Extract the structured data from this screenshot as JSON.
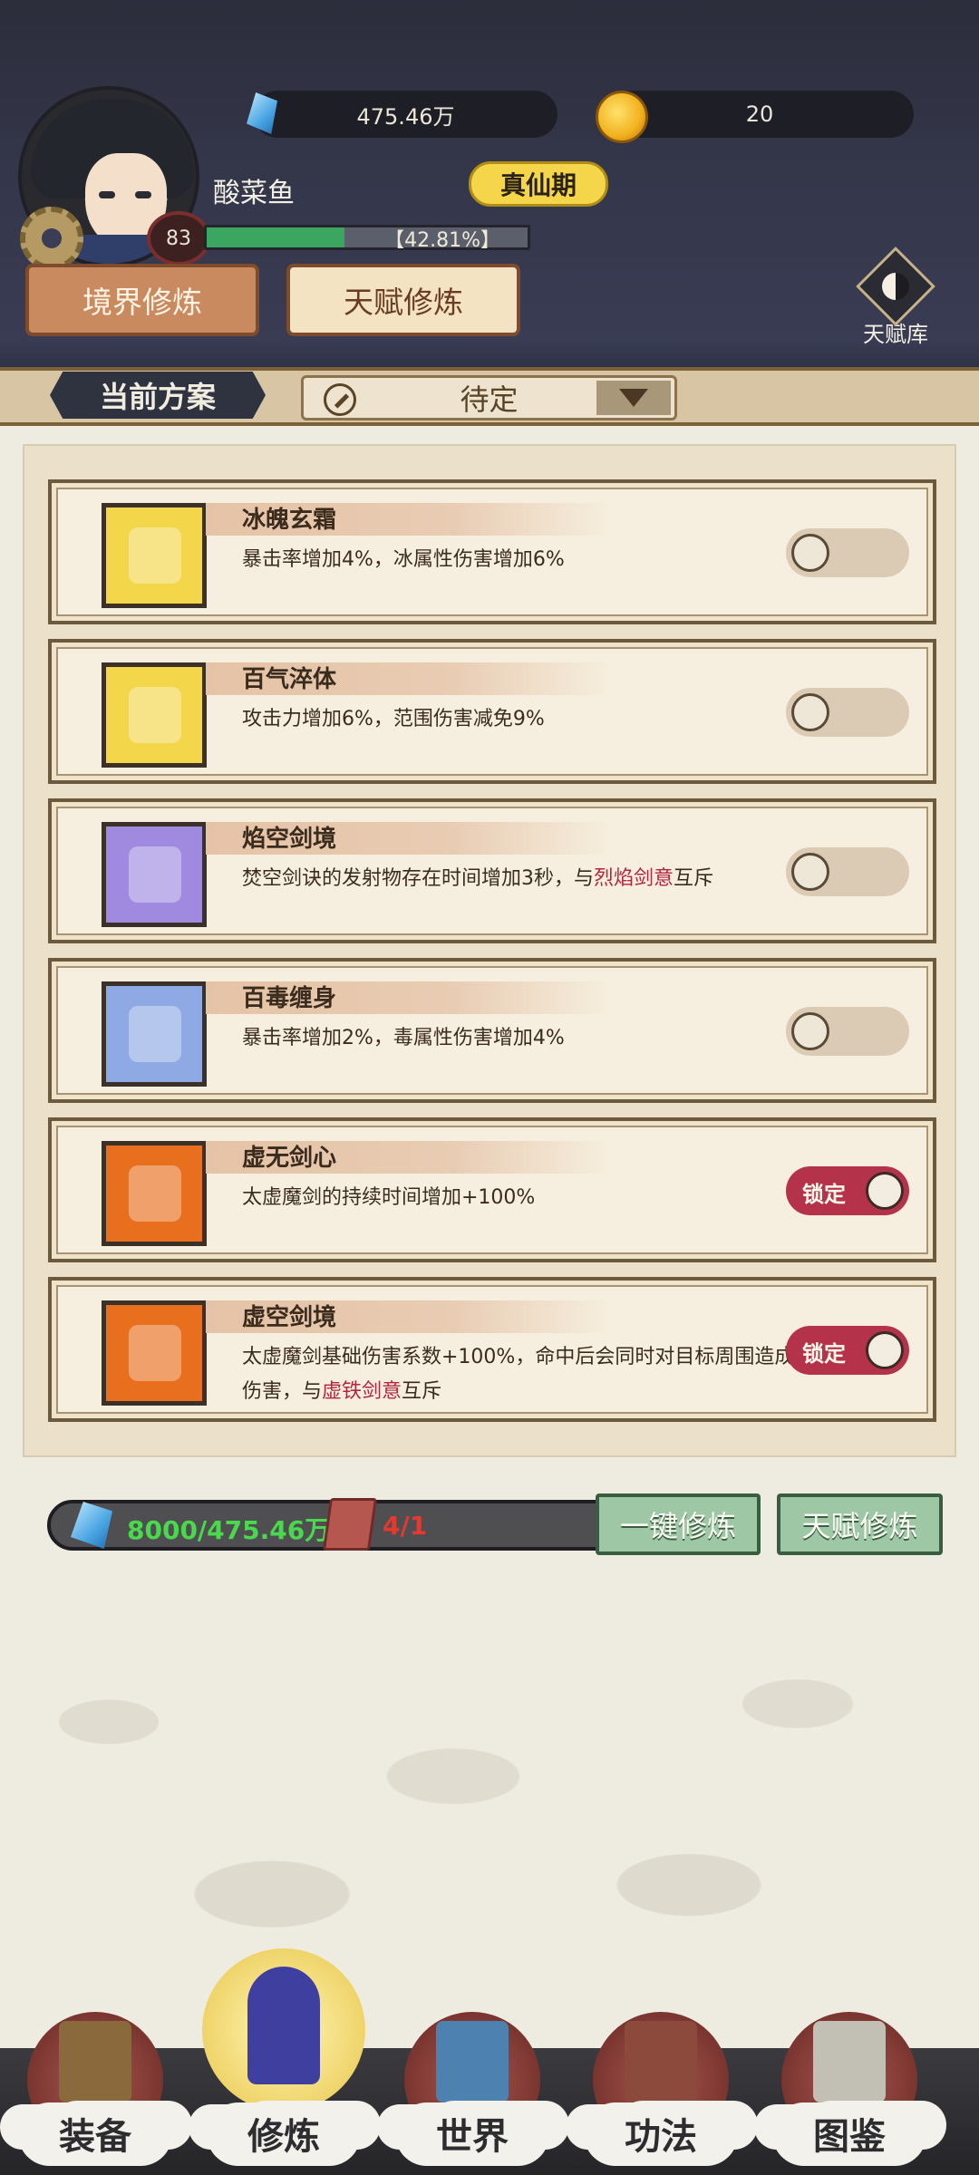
{
  "player": {
    "name": "酸菜鱼",
    "level": "83",
    "realm": "真仙期",
    "exp_text": "【42.81%】",
    "exp_progress": 0.4281
  },
  "resources": {
    "crystal": "475.46万",
    "gold": "20"
  },
  "tabs": {
    "realm_label": "境界修炼",
    "talent_label": "天赋修炼"
  },
  "talent_library_label": "天赋库",
  "scheme": {
    "label": "当前方案",
    "selected": "待定"
  },
  "talents": [
    {
      "name": "冰魄玄霜",
      "desc_parts": [
        "暴击率增加4%，冰属性伤害增加6%"
      ],
      "locked": false,
      "icon": "ice-sword-icon",
      "color": "#f3d64a"
    },
    {
      "name": "百气淬体",
      "desc_parts": [
        "攻击力增加6%，范围伤害减免9%"
      ],
      "locked": false,
      "icon": "flame-blade-icon",
      "color": "#f3d64a"
    },
    {
      "name": "焰空剑境",
      "desc_parts": [
        "焚空剑诀的发射物存在时间增加3秒，与",
        "烈焰剑意",
        "互斥"
      ],
      "locked": false,
      "icon": "fire-claw-icon",
      "color": "#9f8ae0"
    },
    {
      "name": "百毒缠身",
      "desc_parts": [
        "暴击率增加2%，毒属性伤害增加4%"
      ],
      "locked": false,
      "icon": "poison-sword-icon",
      "color": "#8ea9e3"
    },
    {
      "name": "虚无剑心",
      "desc_parts": [
        "太虚魔剑的持续时间增加+100%"
      ],
      "locked": true,
      "lock_label": "锁定",
      "icon": "void-sword-icon",
      "color": "#e86f1d"
    },
    {
      "name": "虚空剑境",
      "desc_parts": [
        "太虚魔剑基础伤害系数+100%，命中后会同时对目标周围造成伤害，与",
        "虚铁剑意",
        "互斥"
      ],
      "locked": true,
      "lock_label": "锁定",
      "icon": "dagger-icon",
      "color": "#e86f1d"
    }
  ],
  "cost": {
    "crystal": "8000/475.46万",
    "books": "4/1"
  },
  "actions": {
    "one_click": "一键修炼",
    "talent_train": "天赋修炼"
  },
  "nav": [
    {
      "label": "装备",
      "icon": "equipment-icon",
      "active": false
    },
    {
      "label": "修炼",
      "icon": "cultivation-icon",
      "active": true
    },
    {
      "label": "世界",
      "icon": "world-map-icon",
      "active": false
    },
    {
      "label": "功法",
      "icon": "scroll-books-icon",
      "active": false
    },
    {
      "label": "图鉴",
      "icon": "codex-book-icon",
      "active": false
    }
  ],
  "colors": {
    "header_bg": "#34364a",
    "accent_green": "#3aa660",
    "lock_red": "#b4334a",
    "panel_bg": "#ebe1cb",
    "action_green": "#9ec7a6"
  }
}
